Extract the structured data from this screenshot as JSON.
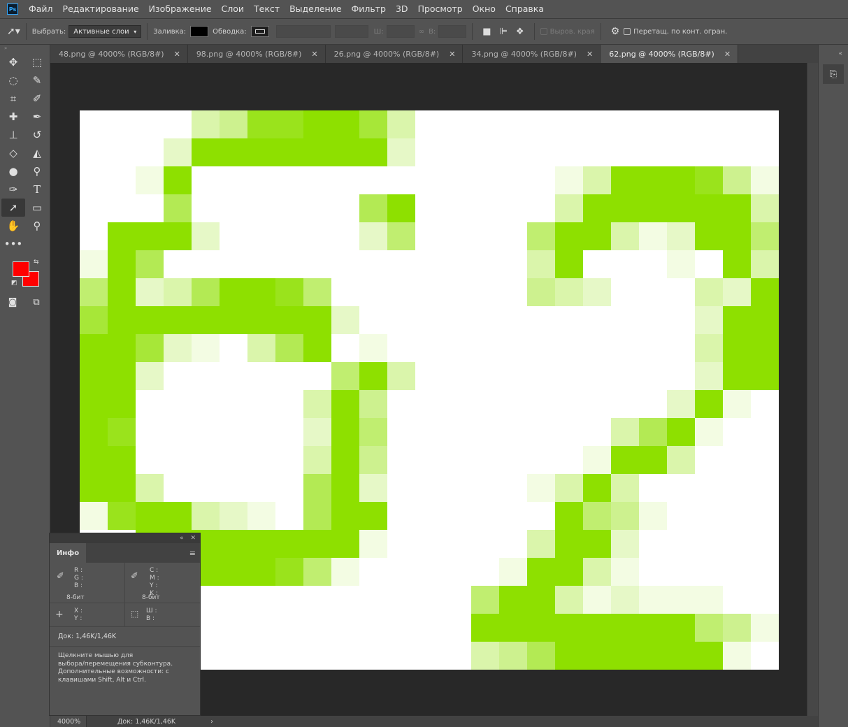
{
  "app": {
    "logo": "Ps"
  },
  "menu": [
    "Файл",
    "Редактирование",
    "Изображение",
    "Слои",
    "Текст",
    "Выделение",
    "Фильтр",
    "3D",
    "Просмотр",
    "Окно",
    "Справка"
  ],
  "options": {
    "select_label": "Выбрать:",
    "select_value": "Активные слои",
    "fill_label": "Заливка:",
    "stroke_label": "Обводка:",
    "width_label": "Ш:",
    "height_label": "В:",
    "align_edges_label": "Выров. края",
    "constrain_label": "Перетащ. по конт. огран."
  },
  "tabs": [
    {
      "label": "48.png @ 4000% (RGB/8#)",
      "active": false
    },
    {
      "label": "98.png @ 4000% (RGB/8#)",
      "active": false
    },
    {
      "label": "26.png @ 4000% (RGB/8#)",
      "active": false
    },
    {
      "label": "34.png @ 4000% (RGB/8#)",
      "active": false
    },
    {
      "label": "62.png @ 4000% (RGB/8#)",
      "active": true
    }
  ],
  "colors": {
    "foreground": "#ff0000",
    "background": "#ff0000",
    "pixel_green": "#8ee000"
  },
  "info_panel": {
    "title": "Инфо",
    "rgb_labels": [
      "R :",
      "G :",
      "B :"
    ],
    "cmyk_labels": [
      "C :",
      "M :",
      "Y :",
      "K :"
    ],
    "bit_left": "8-бит",
    "bit_right": "8-бит",
    "xy_labels": [
      "X :",
      "Y :"
    ],
    "wh_labels": [
      "Ш :",
      "В :"
    ],
    "doc": "Док: 1,46K/1,46K",
    "hint_lines": [
      "Щелкните мышью для",
      "выбора/перемещения субконтура.",
      "Дополнительные возможности: с",
      "клавишами Shift, Alt и Ctrl."
    ]
  },
  "status": {
    "zoom": "4000%",
    "doc": "Док: 1,46K/1,46K"
  },
  "image_pixels": {
    "cols": 25,
    "rows": 20,
    "pixel_color": "#8ee000",
    "alpha_rows": [
      "00000348899730000000000000",
      "00002999999920000000000000",
      "00019000000000000000000000",
      "00006000000694000000000000",
      "00998200000253000000000000",
      "01960000000000000000000000",
      "05923699850000000000000000",
      "07999999992000000000000000",
      "09972103690100000000000000",
      "0992000000590300000000000000",
      "09900000039400000000000000",
      "09800000029500000000000000",
      "09900000039400000000000000",
      "09930000069200000000000000",
      "18993210699000000000000000",
      "00999999991000000000000000",
      "00999998510000000000000000",
      "00000000000000000000000000",
      "00000000000000000000000000",
      "00000000000000000000000000"
    ]
  }
}
